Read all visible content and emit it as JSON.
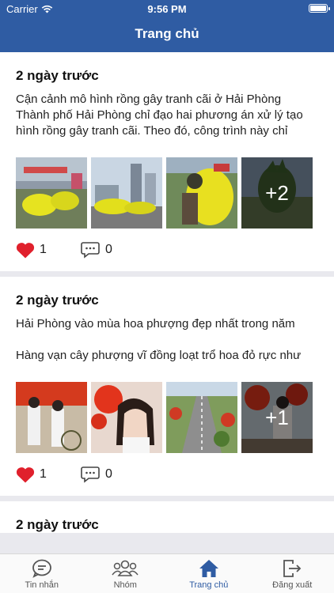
{
  "status_bar": {
    "carrier": "Carrier",
    "time": "9:56 PM"
  },
  "header": {
    "title": "Trang chủ"
  },
  "posts": [
    {
      "date": "2 ngày trước",
      "text": "Cận cảnh mô hình rồng gây tranh cãi ở Hải Phòng\nThành phố Hải Phòng chỉ đạo hai phương án xử lý tạo hình rồng gây tranh cãi. Theo đó, công trình này chỉ được chỉnh sửa sau khi có nhiều ý kiến phản hồi chứ...",
      "more_photos": "+2",
      "likes": "1",
      "comments": "0"
    },
    {
      "date": "2 ngày trước",
      "text": "Hải Phòng vào mùa hoa phượng đẹp nhất trong năm\n\nHàng vạn cây phượng vĩ đồng loạt trổ hoa đỏ rực như \"đốt cháy\" trời Hải Phòng khiến nhiều người dân và d...",
      "more_photos": "+1",
      "likes": "1",
      "comments": "0"
    },
    {
      "date": "2 ngày trước"
    }
  ],
  "tabs": [
    {
      "label": "Tin nhắn",
      "icon": "chat-icon"
    },
    {
      "label": "Nhóm",
      "icon": "group-icon"
    },
    {
      "label": "Trang chủ",
      "icon": "home-icon"
    },
    {
      "label": "Đăng xuất",
      "icon": "logout-icon"
    }
  ],
  "colors": {
    "brand": "#2f5ca3",
    "like": "#e0202c"
  }
}
